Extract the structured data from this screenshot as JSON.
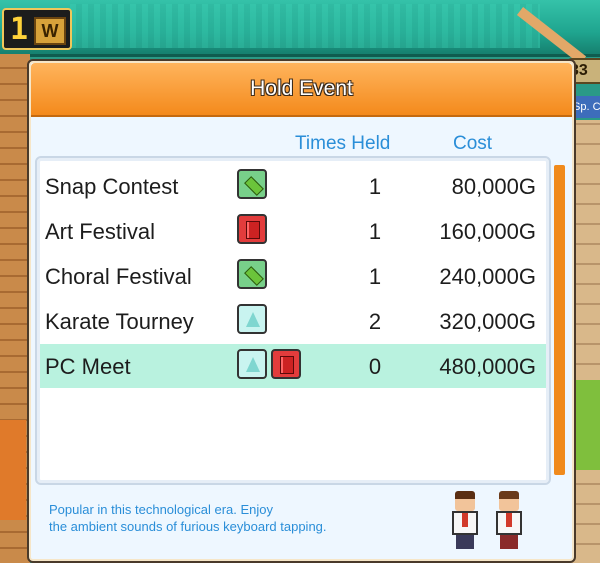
{
  "hud": {
    "week_number": "1",
    "week_label": "W",
    "money_partial": "33",
    "sp_partial": "Sp. C"
  },
  "dialog": {
    "title": "Hold Event",
    "columns": {
      "times_held": "Times Held",
      "cost": "Cost"
    },
    "events": [
      {
        "name": "Snap Contest",
        "icons": [
          "green-pencil-icon"
        ],
        "times_held": "1",
        "cost": "80,000G",
        "selected": false
      },
      {
        "name": "Art Festival",
        "icons": [
          "red-book-icon"
        ],
        "times_held": "1",
        "cost": "160,000G",
        "selected": false
      },
      {
        "name": "Choral Festival",
        "icons": [
          "green-pencil-icon"
        ],
        "times_held": "1",
        "cost": "240,000G",
        "selected": false
      },
      {
        "name": "Karate Tourney",
        "icons": [
          "flask-icon"
        ],
        "times_held": "2",
        "cost": "320,000G",
        "selected": false
      },
      {
        "name": "PC Meet",
        "icons": [
          "flask-icon",
          "red-book-icon"
        ],
        "times_held": "0",
        "cost": "480,000G",
        "selected": true
      }
    ],
    "description_line1": "Popular in this technological era. Enjoy",
    "description_line2": "the ambient sounds of furious keyboard tapping."
  },
  "colors": {
    "header_orange": "#f48a1c",
    "column_blue": "#2a8ed8",
    "selected_row": "#b9f2df",
    "scrollbar": "#f08a1c"
  }
}
